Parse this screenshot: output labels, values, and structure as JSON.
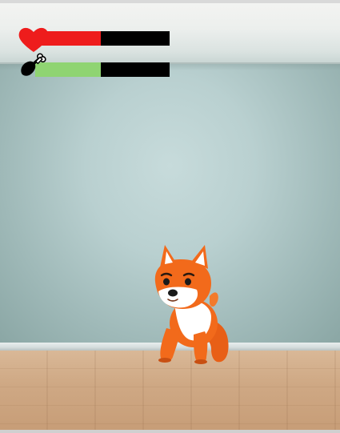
{
  "hud": {
    "health": {
      "icon": "heart-icon",
      "level": 0.49,
      "fill_color": "#ee1c1c",
      "track_color": "#000000"
    },
    "hunger": {
      "icon": "drumstick-icon",
      "level": 0.49,
      "fill_color": "#8fd472",
      "track_color": "#000000"
    }
  },
  "pet": {
    "icon": "shiba-dog",
    "colors": {
      "fur": "#f26a1b",
      "chest": "#ffffff"
    }
  },
  "scene": {
    "wall_color": "#b9d0d0",
    "floor_color": "#cfa985"
  }
}
